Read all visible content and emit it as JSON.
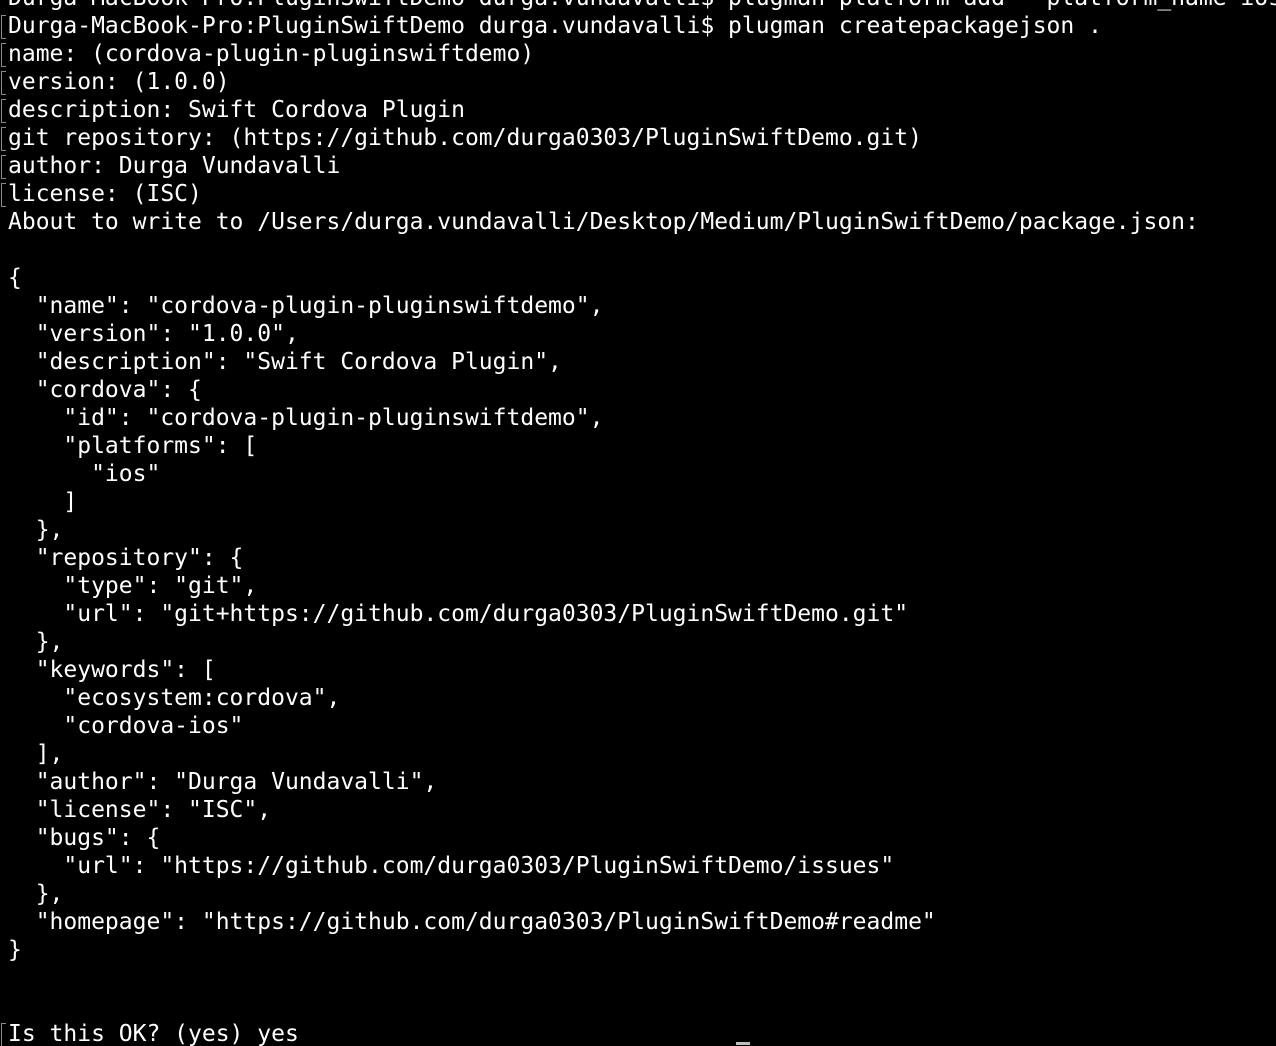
{
  "terminal": {
    "lines": [
      {
        "text": "Durga-MacBook-Pro:PluginSwiftDemo durga.vundavalli$ plugman platform add --platform_name ios",
        "marked": false
      },
      {
        "text": "Durga-MacBook-Pro:PluginSwiftDemo durga.vundavalli$ plugman createpackagejson .",
        "marked": true
      },
      {
        "text": "name: (cordova-plugin-pluginswiftdemo)",
        "marked": true
      },
      {
        "text": "version: (1.0.0)",
        "marked": true
      },
      {
        "text": "description: Swift Cordova Plugin",
        "marked": true
      },
      {
        "text": "git repository: (https://github.com/durga0303/PluginSwiftDemo.git)",
        "marked": true
      },
      {
        "text": "author: Durga Vundavalli",
        "marked": true
      },
      {
        "text": "license: (ISC)",
        "marked": true
      },
      {
        "text": "About to write to /Users/durga.vundavalli/Desktop/Medium/PluginSwiftDemo/package.json:",
        "marked": false
      },
      {
        "text": "",
        "marked": false
      },
      {
        "text": "{",
        "marked": false
      },
      {
        "text": "  \"name\": \"cordova-plugin-pluginswiftdemo\",",
        "marked": false
      },
      {
        "text": "  \"version\": \"1.0.0\",",
        "marked": false
      },
      {
        "text": "  \"description\": \"Swift Cordova Plugin\",",
        "marked": false
      },
      {
        "text": "  \"cordova\": {",
        "marked": false
      },
      {
        "text": "    \"id\": \"cordova-plugin-pluginswiftdemo\",",
        "marked": false
      },
      {
        "text": "    \"platforms\": [",
        "marked": false
      },
      {
        "text": "      \"ios\"",
        "marked": false
      },
      {
        "text": "    ]",
        "marked": false
      },
      {
        "text": "  },",
        "marked": false
      },
      {
        "text": "  \"repository\": {",
        "marked": false
      },
      {
        "text": "    \"type\": \"git\",",
        "marked": false
      },
      {
        "text": "    \"url\": \"git+https://github.com/durga0303/PluginSwiftDemo.git\"",
        "marked": false
      },
      {
        "text": "  },",
        "marked": false
      },
      {
        "text": "  \"keywords\": [",
        "marked": false
      },
      {
        "text": "    \"ecosystem:cordova\",",
        "marked": false
      },
      {
        "text": "    \"cordova-ios\"",
        "marked": false
      },
      {
        "text": "  ],",
        "marked": false
      },
      {
        "text": "  \"author\": \"Durga Vundavalli\",",
        "marked": false
      },
      {
        "text": "  \"license\": \"ISC\",",
        "marked": false
      },
      {
        "text": "  \"bugs\": {",
        "marked": false
      },
      {
        "text": "    \"url\": \"https://github.com/durga0303/PluginSwiftDemo/issues\"",
        "marked": false
      },
      {
        "text": "  },",
        "marked": false
      },
      {
        "text": "  \"homepage\": \"https://github.com/durga0303/PluginSwiftDemo#readme\"",
        "marked": false
      },
      {
        "text": "}",
        "marked": false
      },
      {
        "text": "",
        "marked": false
      },
      {
        "text": "",
        "marked": false
      },
      {
        "text": "Is this OK? (yes) yes",
        "marked": true
      }
    ]
  }
}
